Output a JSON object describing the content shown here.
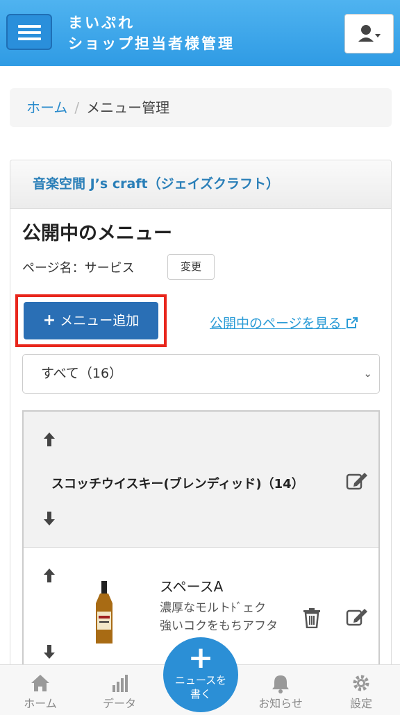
{
  "header": {
    "brand_line1": "まいぷれ",
    "brand_line2": "ショップ担当者様管理",
    "accent_color": "#2f9be4"
  },
  "breadcrumb": {
    "home": "ホーム",
    "separator": "/",
    "current": "メニュー管理"
  },
  "panel": {
    "shop_name": "音楽空間 J’s craft（ジェイズクラフト）",
    "title": "公開中のメニュー",
    "page_name_label": "ページ名：サービス",
    "change_label": "変更",
    "add_menu_label": "メニュー追加",
    "view_public_label": "公開中のページを見る",
    "filter_selected": "すべて（16）"
  },
  "list": {
    "category": {
      "name": "スコッチウイスキー(ブレンディッド)（14）"
    },
    "item": {
      "name": "スペースA",
      "desc_line1": "濃厚なモルトﾄﾞェク",
      "desc_line2": "強いコクをもちアフタ"
    }
  },
  "tabbar": {
    "home": "ホーム",
    "data": "データ",
    "news_line1": "ニュースを",
    "news_line2": "書く",
    "notice": "お知らせ",
    "settings": "設定"
  }
}
